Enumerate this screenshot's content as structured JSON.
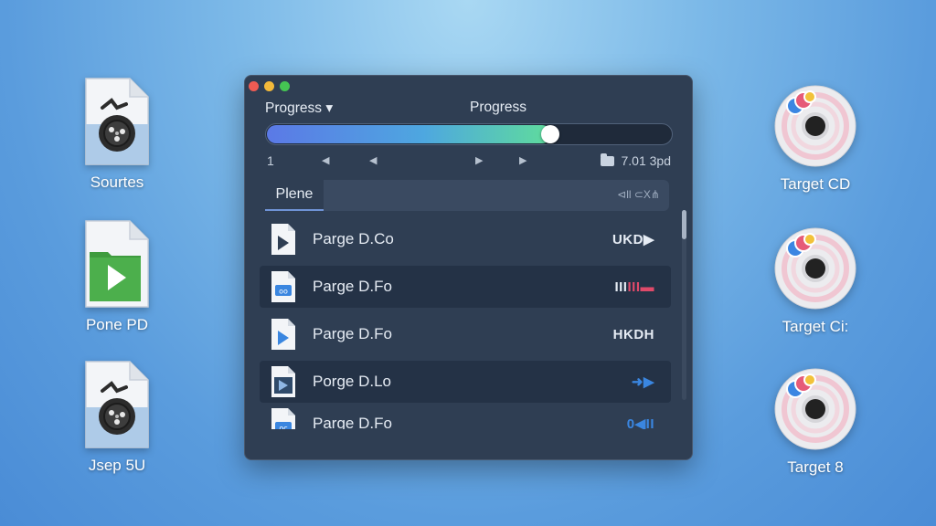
{
  "desktop_left": [
    {
      "label": "Sourtes",
      "icon": "disk-document-icon"
    },
    {
      "label": "Pone PD",
      "icon": "video-file-icon"
    },
    {
      "label": "Jsep 5U",
      "icon": "disk-document-icon"
    }
  ],
  "desktop_right": [
    {
      "label": "Target CD"
    },
    {
      "label": "Target Ci:"
    },
    {
      "label": "Target 8"
    }
  ],
  "window": {
    "progress_left_label": "Progress ▾",
    "progress_center_label": "Progress",
    "progress_value": 0.7,
    "counter": "1",
    "arrows": [
      "◀",
      "◀",
      "▶",
      "▶"
    ],
    "size_label": "7.01 3pd",
    "filter_tab": "Plene",
    "filter_right": "⊲ll ⊂X⋔",
    "rows": [
      {
        "name": "Parge D.Co",
        "trail": "UKD▶"
      },
      {
        "name": "Parge D.Fo",
        "trail": "III▬"
      },
      {
        "name": "Parge D.Fo",
        "trail": "HKDH"
      },
      {
        "name": "Porge D.Lo",
        "trail": "➜▶"
      },
      {
        "name": "Parge D.Fo",
        "trail": "0◀II"
      }
    ]
  },
  "colors": {
    "window_bg": "#2f3e53",
    "accent_blue": "#3a86e0",
    "accent_red": "#e04a6a"
  }
}
